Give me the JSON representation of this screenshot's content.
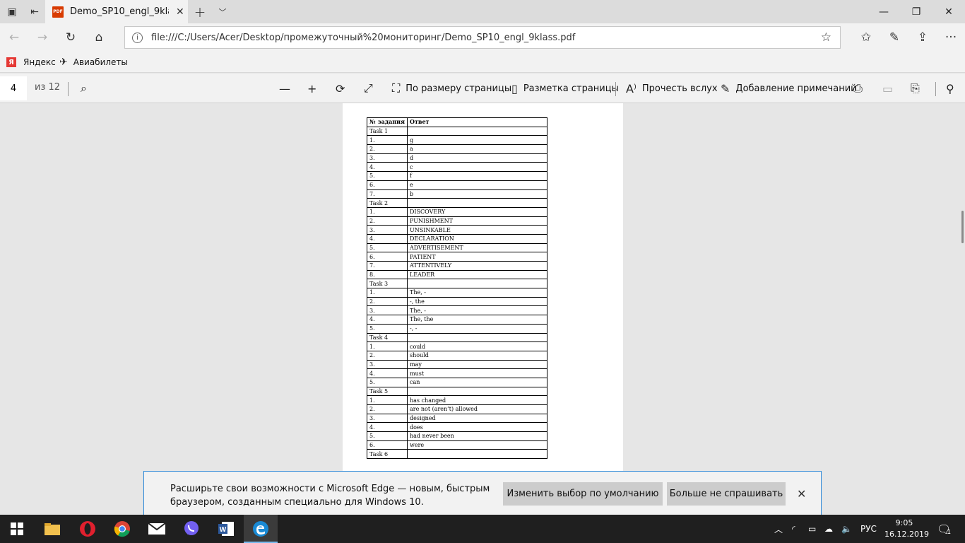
{
  "tabs": {
    "active_title": "Demo_SP10_engl_9klass.pdf",
    "file_badge": "PDF"
  },
  "address": {
    "url": "file:///C:/Users/Acer/Desktop/промежуточный%20мониторинг/Demo_SP10_engl_9klass.pdf"
  },
  "favorites": [
    {
      "label": "Яндекс",
      "icon": "yandex-icon"
    },
    {
      "label": "Авиабилеты",
      "icon": "airplane-icon"
    }
  ],
  "yandex_letter": "Я",
  "pdf_toolbar": {
    "page": "4",
    "page_of": "из 12",
    "fit_page": "По размеру страницы",
    "page_layout": "Разметка страницы",
    "read_aloud": "Прочесть вслух",
    "add_notes": "Добавление примечаний"
  },
  "answers_table": {
    "headers": [
      "№ задания",
      "Ответ"
    ],
    "rows": [
      [
        "Task 1",
        ""
      ],
      [
        "1.",
        "g"
      ],
      [
        "2.",
        "a"
      ],
      [
        "3.",
        "d"
      ],
      [
        "4.",
        "c"
      ],
      [
        "5.",
        "f"
      ],
      [
        "6.",
        "e"
      ],
      [
        "7.",
        "b"
      ],
      [
        "Task 2",
        ""
      ],
      [
        "1.",
        "DISCOVERY"
      ],
      [
        "2.",
        "PUNISHMENT"
      ],
      [
        "3.",
        "UNSINKABLE"
      ],
      [
        "4.",
        "DECLARATION"
      ],
      [
        "5.",
        "ADVERTISEMENT"
      ],
      [
        "6.",
        "PATIENT"
      ],
      [
        "7.",
        "ATTENTIVELY"
      ],
      [
        "8.",
        "LEADER"
      ],
      [
        "Task 3",
        ""
      ],
      [
        "1.",
        "The, -"
      ],
      [
        "2.",
        "-, the"
      ],
      [
        "3.",
        "The, -"
      ],
      [
        "4.",
        "The, the"
      ],
      [
        "5.",
        "-, -"
      ],
      [
        "Task 4",
        ""
      ],
      [
        "1.",
        "could"
      ],
      [
        "2.",
        "should"
      ],
      [
        "3.",
        "may"
      ],
      [
        "4.",
        "must"
      ],
      [
        "5.",
        "can"
      ],
      [
        "Task 5",
        ""
      ],
      [
        "1.",
        "has changed"
      ],
      [
        "2.",
        "are not (aren’t) allowed"
      ],
      [
        "3.",
        "designed"
      ],
      [
        "4.",
        "does"
      ],
      [
        "5.",
        "had never been"
      ],
      [
        "6.",
        "were"
      ],
      [
        "Task 6",
        ""
      ]
    ]
  },
  "notification": {
    "message": "Расширьте свои возможности с Microsoft Edge — новым, быстрым браузером, созданным специально для Windows 10.",
    "change_default": "Изменить выбор по умолчанию",
    "dont_ask": "Больше не спрашивать"
  },
  "taskbar": {
    "lang": "РУС",
    "time": "9:05",
    "date": "16.12.2019",
    "notifications_count": "1"
  },
  "colors": {
    "accent": "#2b88d8",
    "taskbar": "#1f1f1f",
    "pdf_badge": "#d83b01"
  }
}
